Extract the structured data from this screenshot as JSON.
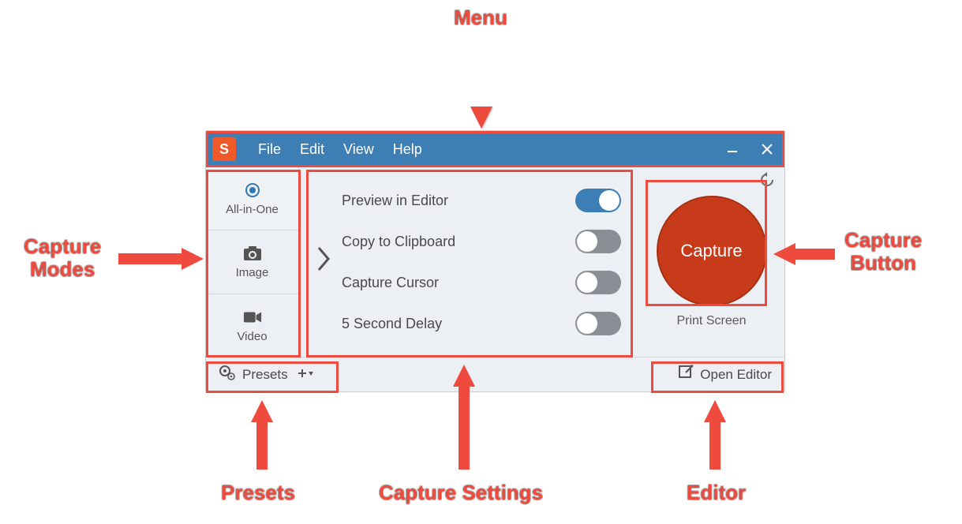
{
  "logo_letter": "S",
  "menu": {
    "items": [
      "File",
      "Edit",
      "View",
      "Help"
    ]
  },
  "modes": [
    {
      "label": "All-in-One",
      "icon": "target-icon",
      "active": true
    },
    {
      "label": "Image",
      "icon": "camera-icon",
      "active": false
    },
    {
      "label": "Video",
      "icon": "video-icon",
      "active": false
    }
  ],
  "settings": [
    {
      "label": "Preview in Editor",
      "on": true
    },
    {
      "label": "Copy to Clipboard",
      "on": false
    },
    {
      "label": "Capture Cursor",
      "on": false
    },
    {
      "label": "5 Second Delay",
      "on": false
    }
  ],
  "capture": {
    "button_label": "Capture",
    "hotkey_label": "Print Screen"
  },
  "footer": {
    "presets_label": "Presets",
    "open_editor_label": "Open Editor"
  },
  "annotations": {
    "menu": "Menu",
    "capture_modes": "Capture\nModes",
    "capture_button": "Capture\nButton",
    "presets": "Presets",
    "capture_settings": "Capture Settings",
    "editor": "Editor"
  },
  "colors": {
    "callout": "#ee4a3d",
    "menubar": "#3d7fb5",
    "capture_button": "#c73a1a",
    "app_bg": "#eceff3"
  }
}
